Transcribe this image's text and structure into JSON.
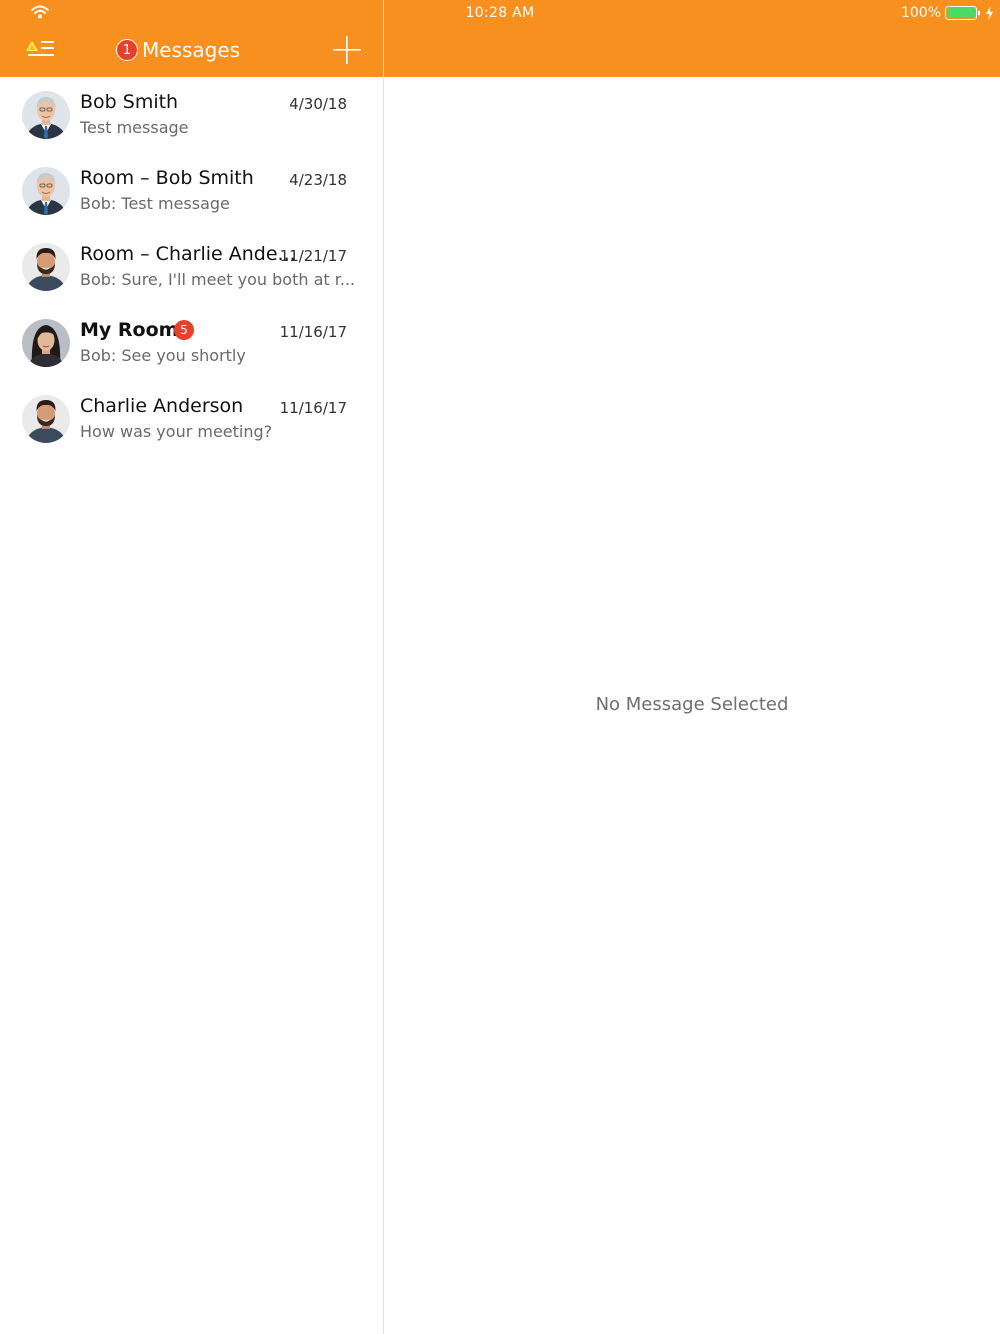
{
  "status_bar": {
    "time": "10:28 AM",
    "battery": "100%"
  },
  "nav": {
    "title": "Messages",
    "badge": "1"
  },
  "conversations": [
    {
      "name": "Bob Smith",
      "date": "4/30/18",
      "preview": "Test message",
      "avatar": "man-gray-hair"
    },
    {
      "name": "Room – Bob Smith",
      "date": "4/23/18",
      "preview": "Bob: Test message",
      "avatar": "man-gray-hair"
    },
    {
      "name": "Room – Charlie Ande...",
      "date": "11/21/17",
      "preview": "Bob: Sure, I'll meet you both at r...",
      "avatar": "man-beard"
    },
    {
      "name": "My Room",
      "badge": "5",
      "date": "11/16/17",
      "preview": "Bob: See you shortly",
      "avatar": "woman"
    },
    {
      "name": "Charlie Anderson",
      "date": "11/16/17",
      "preview": "How was your meeting?",
      "avatar": "man-beard"
    }
  ],
  "detail": {
    "empty_text": "No Message Selected"
  },
  "colors": {
    "accent": "#f7901e",
    "badge": "#e8402c",
    "battery": "#4cd964"
  }
}
